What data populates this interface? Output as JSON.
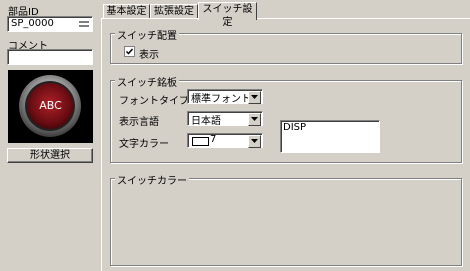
{
  "left": {
    "part_id_label": "部品ID",
    "part_id_value": "SP_0000",
    "comment_label": "コメント",
    "comment_value": "",
    "preview_text": "ABC",
    "shape_button": "形状選択"
  },
  "tabs": [
    {
      "label": "基本設定"
    },
    {
      "label": "拡張設定"
    },
    {
      "label": "スイッチ設定"
    }
  ],
  "switch_layout": {
    "title": "スイッチ配置",
    "show_label": "表示",
    "show_checked": true
  },
  "switch_nameplate": {
    "title": "スイッチ銘板",
    "font_type_label": "フォントタイプ",
    "font_type_value": "標準フォント",
    "language_label": "表示言語",
    "language_value": "日本語",
    "text_color_label": "文字カラー",
    "text_color_value": "7",
    "text_area_value": "DISP"
  },
  "switch_color": {
    "title": "スイッチカラー"
  }
}
